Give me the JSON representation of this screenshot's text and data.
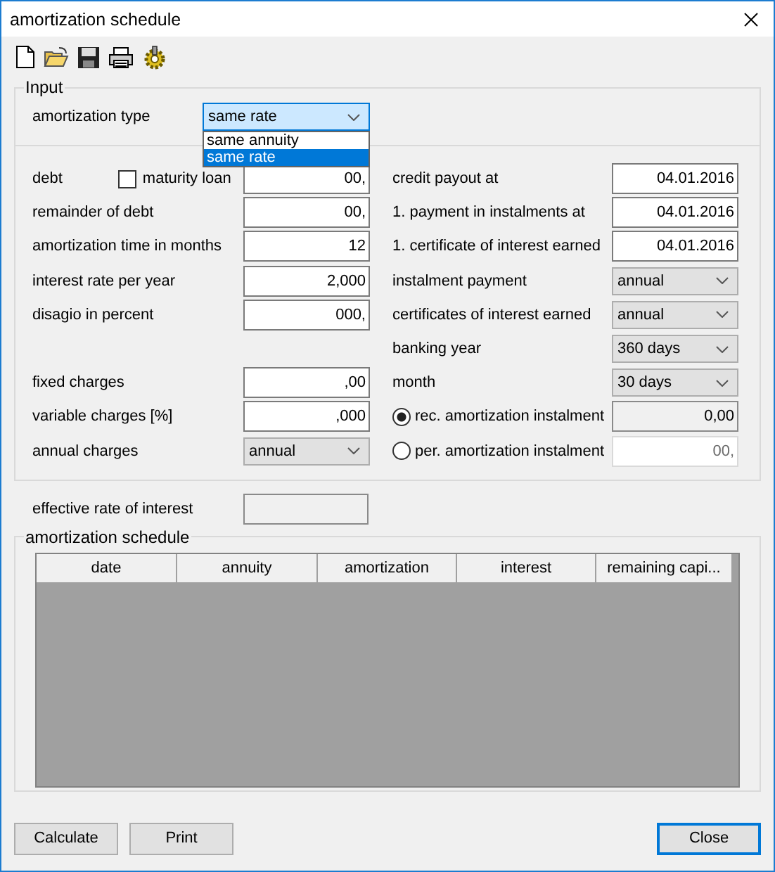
{
  "window": {
    "title": "amortization schedule"
  },
  "input": {
    "label": "Input",
    "amortization_type": {
      "label": "amortization type",
      "value": "same rate",
      "expanded": true,
      "options": [
        {
          "label": "same annuity",
          "selected": false
        },
        {
          "label": "same rate",
          "selected": true
        }
      ]
    },
    "left_fields": [
      {
        "label": "debt",
        "checkbox": {
          "label": "maturity loan",
          "checked": false
        },
        "field": {
          "kind": "text",
          "value": "00,"
        }
      },
      {
        "label": "remainder of debt",
        "field": {
          "kind": "text",
          "value": "00,"
        }
      },
      {
        "label": "amortization time in months",
        "field": {
          "kind": "text",
          "value": "12"
        }
      },
      {
        "label": "interest rate per year",
        "field": {
          "kind": "text",
          "value": "2,000"
        }
      },
      {
        "label": "disagio in percent",
        "field": {
          "kind": "text",
          "value": "000,"
        }
      }
    ],
    "charges": [
      {
        "label": "fixed charges",
        "field": {
          "kind": "text",
          "value": ",00"
        }
      },
      {
        "label": "variable charges [%]",
        "field": {
          "kind": "text",
          "value": ",000"
        }
      },
      {
        "label": "annual charges",
        "field": {
          "kind": "combo",
          "value": "annual"
        }
      }
    ],
    "right_fields": [
      {
        "label": "credit payout at",
        "field": {
          "kind": "text",
          "value": "04.01.2016"
        }
      },
      {
        "label": "1. payment in instalments at",
        "field": {
          "kind": "text",
          "value": "04.01.2016"
        }
      },
      {
        "label": "1. certificate of interest earned",
        "field": {
          "kind": "text",
          "value": "04.01.2016"
        }
      },
      {
        "label": "instalment payment",
        "field": {
          "kind": "combo",
          "value": "annual"
        }
      },
      {
        "label": "certificates of interest earned",
        "field": {
          "kind": "combo",
          "value": "annual"
        }
      },
      {
        "label": "banking year",
        "field": {
          "kind": "combo",
          "value": "360 days"
        }
      },
      {
        "label": "month",
        "field": {
          "kind": "combo",
          "value": "30 days"
        }
      },
      {
        "label": "rec. amortization instalment",
        "radio": {
          "selected": true
        },
        "field": {
          "kind": "readonly",
          "value": "0,00"
        }
      },
      {
        "label": "per. amortization instalment",
        "radio": {
          "selected": false
        },
        "field": {
          "kind": "disabled",
          "value": "00,"
        }
      }
    ]
  },
  "effective_rate": {
    "label": "effective rate of interest",
    "field": {
      "kind": "readonly"
    }
  },
  "schedule": {
    "label": "amortization schedule",
    "columns": [
      "date",
      "annuity",
      "amortization",
      "interest",
      "remaining capi..."
    ]
  },
  "buttons": [
    {
      "label": "Calculate",
      "focused": false
    },
    {
      "label": "Print",
      "focused": false
    },
    {
      "label": "Close",
      "focused": true
    }
  ]
}
